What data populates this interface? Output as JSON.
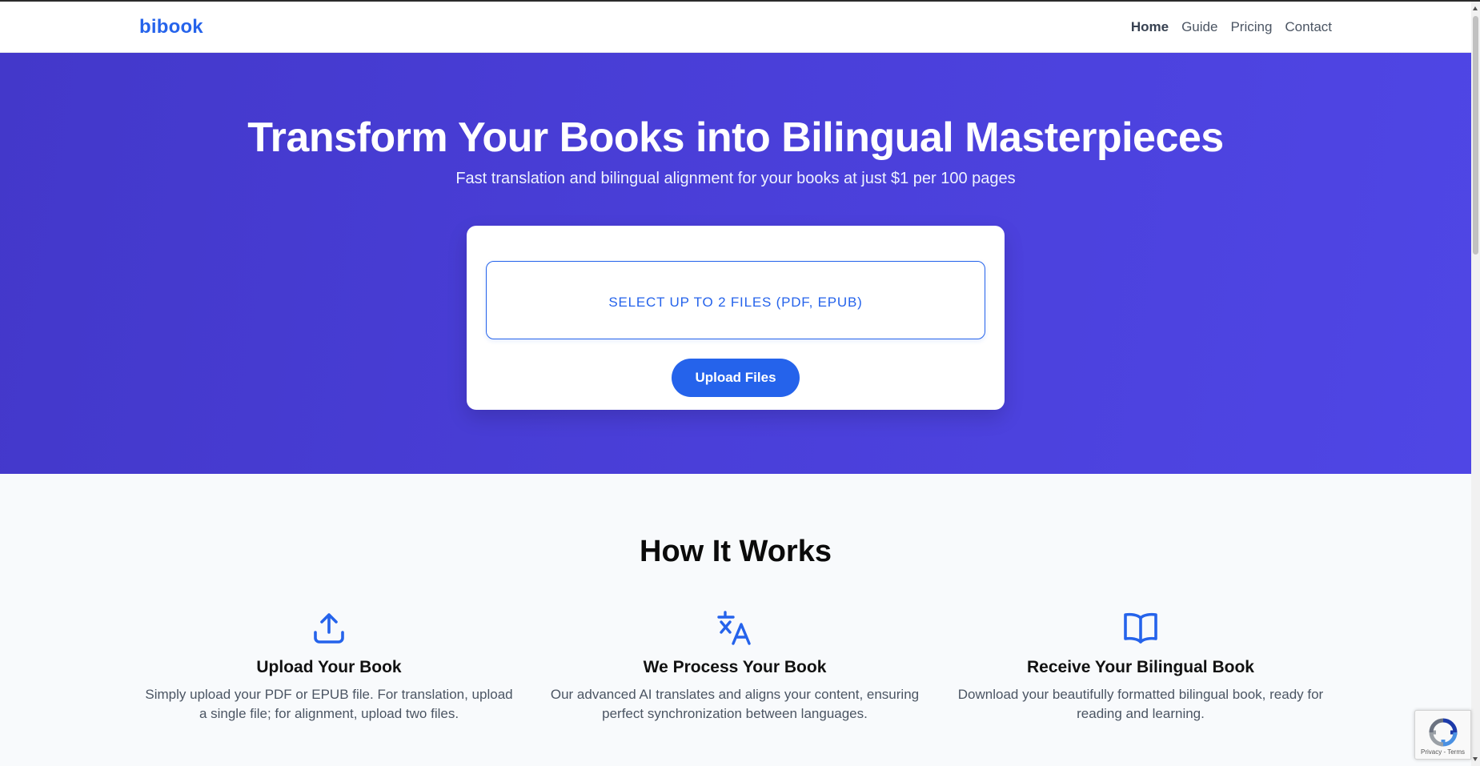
{
  "brand": "bibook",
  "nav": {
    "items": [
      {
        "label": "Home",
        "active": true
      },
      {
        "label": "Guide",
        "active": false
      },
      {
        "label": "Pricing",
        "active": false
      },
      {
        "label": "Contact",
        "active": false
      }
    ]
  },
  "hero": {
    "title": "Transform Your Books into Bilingual Masterpieces",
    "subtitle": "Fast translation and bilingual alignment for your books at just $1 per 100 pages",
    "file_select_label": "SELECT UP TO 2 FILES (PDF, EPUB)",
    "upload_button": "Upload Files"
  },
  "how": {
    "title": "How It Works",
    "steps": [
      {
        "icon": "upload-icon",
        "title": "Upload Your Book",
        "desc": "Simply upload your PDF or EPUB file. For translation, upload a single file; for alignment, upload two files."
      },
      {
        "icon": "translate-icon",
        "title": "We Process Your Book",
        "desc": "Our advanced AI translates and aligns your content, ensuring perfect synchronization between languages."
      },
      {
        "icon": "book-open-icon",
        "title": "Receive Your Bilingual Book",
        "desc": "Download your beautifully formatted bilingual book, ready for reading and learning."
      }
    ]
  },
  "recaptcha": {
    "text": "Privacy - Terms"
  },
  "colors": {
    "accent": "#2563eb",
    "hero_bg": "#4338ca",
    "section_bg": "#f8fafc"
  }
}
